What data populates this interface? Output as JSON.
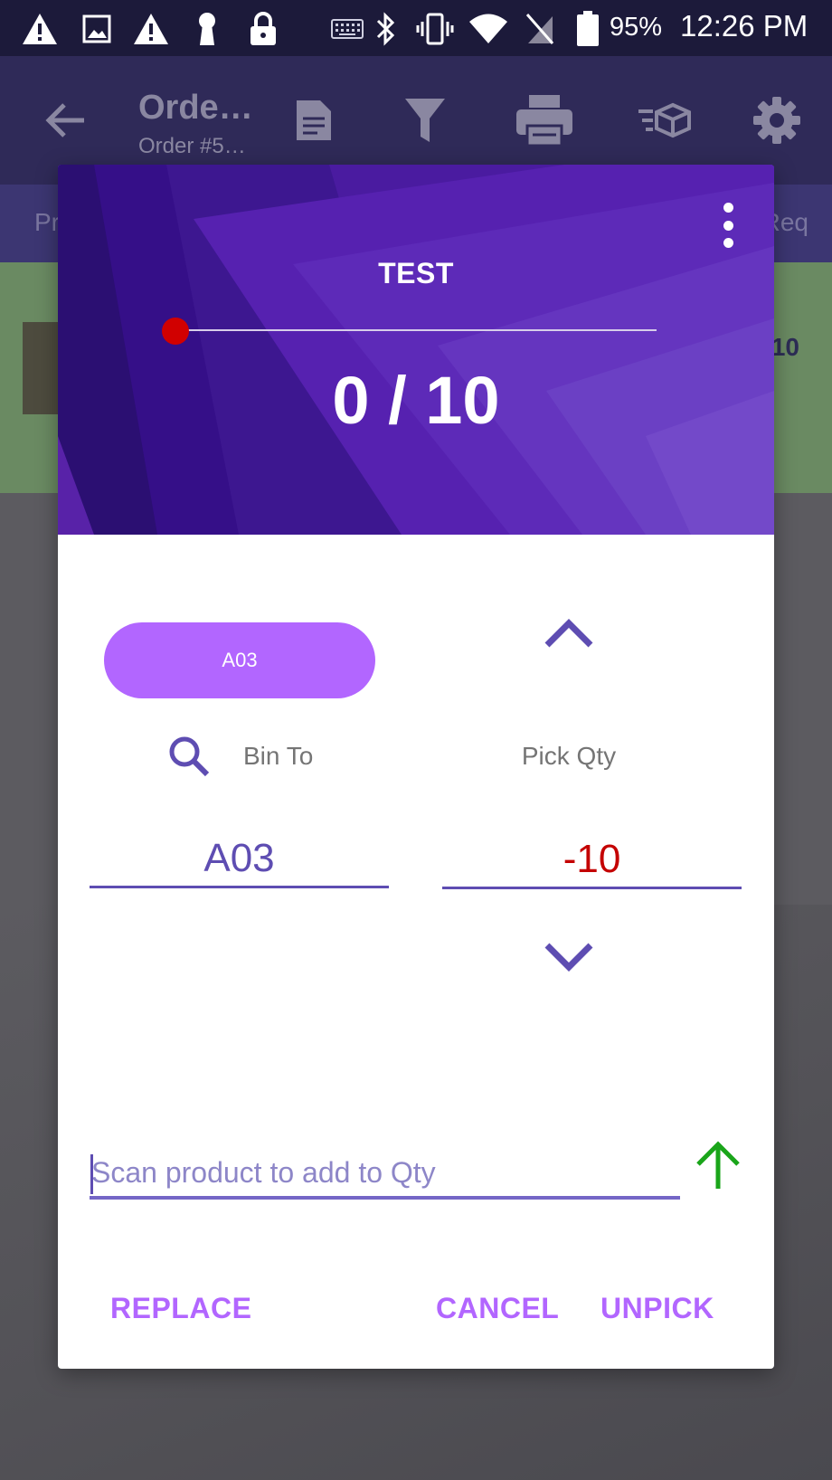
{
  "status_bar": {
    "battery": "95%",
    "time": "12:26 PM",
    "icons": [
      "warning-icon",
      "image-icon",
      "warning-icon",
      "keyhole-icon",
      "lock-icon",
      "keyboard-icon",
      "bluetooth-icon",
      "vibrate-icon",
      "wifi-icon",
      "no-sim-icon",
      "battery-icon"
    ]
  },
  "app_bar": {
    "title": "Orde…",
    "subtitle": "Order #5…",
    "icons": [
      "back-arrow-icon",
      "document-icon",
      "filter-icon",
      "printer-icon",
      "box-list-icon",
      "settings-icon"
    ]
  },
  "background": {
    "tab_left": "Pr",
    "tab_right": "Req",
    "row_qty": "10"
  },
  "dialog": {
    "title": "TEST",
    "progress": {
      "picked": 0,
      "total": 10,
      "text": "0 / 10"
    },
    "bin_button": "A03",
    "bin_label": "Bin To",
    "bin_value": "A03",
    "qty_label": "Pick Qty",
    "qty_value": "-10",
    "scan_placeholder": "Scan product to add to Qty",
    "buttons": {
      "replace": "REPLACE",
      "cancel": "CANCEL",
      "unpick": "UNPICK"
    }
  },
  "colors": {
    "accent": "#b266ff",
    "primary": "#5e4db2",
    "negative": "#c40000",
    "progress_thumb": "#d10000",
    "submit_arrow": "#1aa51a"
  }
}
